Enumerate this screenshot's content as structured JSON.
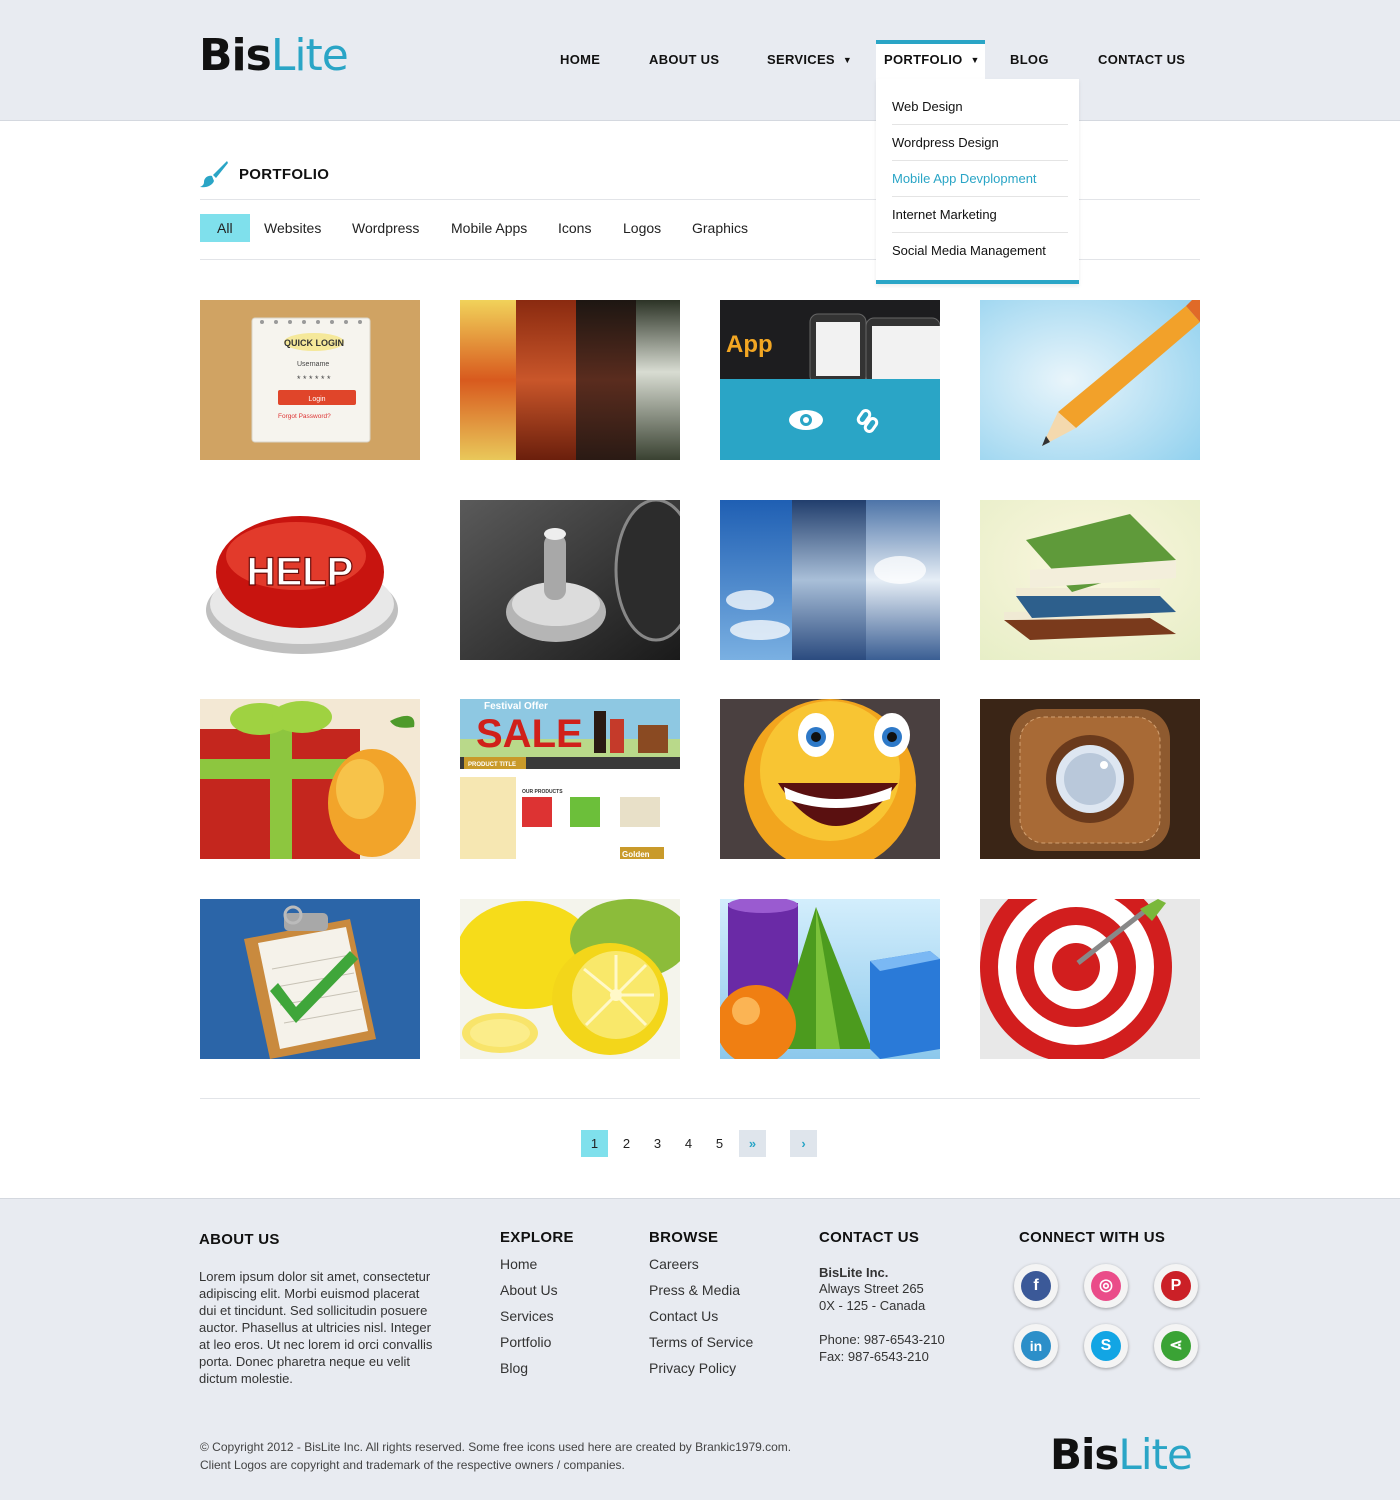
{
  "brand": {
    "part1": "Bis",
    "part2": "Lite"
  },
  "colors": {
    "accent": "#2aa5c6",
    "highlight": "#7fe0ec",
    "header_bg": "#e8ebf1"
  },
  "nav": {
    "items": [
      {
        "label": "HOME"
      },
      {
        "label": "ABOUT US"
      },
      {
        "label": "SERVICES",
        "has_dropdown": true
      },
      {
        "label": "PORTFOLIO",
        "has_dropdown": true,
        "active": true
      },
      {
        "label": "BLOG"
      },
      {
        "label": "CONTACT US"
      }
    ],
    "dropdown": [
      {
        "label": "Web Design"
      },
      {
        "label": "Wordpress Design"
      },
      {
        "label": "Mobile App Devplopment",
        "highlighted": true
      },
      {
        "label": "Internet Marketing"
      },
      {
        "label": "Social Media Management"
      }
    ]
  },
  "page": {
    "title": "PORTFOLIO",
    "title_icon": "paintbrush-icon"
  },
  "filters": [
    {
      "label": "All",
      "active": true
    },
    {
      "label": "Websites"
    },
    {
      "label": "Wordpress"
    },
    {
      "label": "Mobile Apps"
    },
    {
      "label": "Icons"
    },
    {
      "label": "Logos"
    },
    {
      "label": "Graphics"
    }
  ],
  "portfolio": [
    {
      "name": "quick-login-notepad",
      "text": "QUICK LOGIN",
      "sub": [
        "Username",
        "Login",
        "Forgot Password?"
      ]
    },
    {
      "name": "texture-strips"
    },
    {
      "name": "app-showcase",
      "text": "App",
      "hover_icons": [
        "eye-icon",
        "link-icon"
      ]
    },
    {
      "name": "pencil-icon-art"
    },
    {
      "name": "help-button",
      "text": "HELP"
    },
    {
      "name": "spinning-top-photo"
    },
    {
      "name": "sky-textures"
    },
    {
      "name": "books-stack"
    },
    {
      "name": "gift-and-mango"
    },
    {
      "name": "festival-sale-site",
      "text": "SALE",
      "sub": [
        "Festival Offer",
        "PRODUCT TITLE",
        "OUR PRODUCTS",
        "Golden"
      ]
    },
    {
      "name": "smiley-face"
    },
    {
      "name": "leather-knob-icon"
    },
    {
      "name": "clipboard-check"
    },
    {
      "name": "lemons"
    },
    {
      "name": "3d-shapes"
    },
    {
      "name": "target-dart"
    }
  ],
  "pagination": {
    "pages": [
      "1",
      "2",
      "3",
      "4",
      "5"
    ],
    "current": "1",
    "last": "»",
    "next": "›"
  },
  "footer": {
    "about": {
      "heading": "ABOUT US",
      "text": "Lorem ipsum dolor sit amet, consectetur adipiscing elit. Morbi euismod placerat dui et tincidunt. Sed sollicitudin posuere auctor. Phasellus at ultricies nisl. Integer at leo eros. Ut nec lorem id orci convallis porta. Donec pharetra neque eu velit dictum molestie."
    },
    "explore": {
      "heading": "EXPLORE",
      "links": [
        "Home",
        "About Us",
        "Services",
        "Portfolio",
        "Blog"
      ]
    },
    "browse": {
      "heading": "BROWSE",
      "links": [
        "Careers",
        "Press & Media",
        "Contact Us",
        "Terms of Service",
        "Privacy Policy"
      ]
    },
    "contact": {
      "heading": "CONTACT US",
      "company": "BisLite Inc.",
      "address1": "Always Street 265",
      "address2": "0X - 125 - Canada",
      "phone": "Phone: 987-6543-210",
      "fax": "Fax: 987-6543-210"
    },
    "connect": {
      "heading": "CONNECT WITH US",
      "networks": [
        {
          "name": "facebook",
          "icon": "facebook-icon",
          "glyph": "f",
          "color": "#3b5998"
        },
        {
          "name": "dribbble",
          "icon": "dribbble-icon",
          "glyph": "◎",
          "color": "#ea4c89"
        },
        {
          "name": "pinterest",
          "icon": "pinterest-icon",
          "glyph": "P",
          "color": "#cb2027"
        },
        {
          "name": "linkedin",
          "icon": "linkedin-icon",
          "glyph": "in",
          "color": "#2c8fc9"
        },
        {
          "name": "skype",
          "icon": "skype-icon",
          "glyph": "S",
          "color": "#12a5e4"
        },
        {
          "name": "share",
          "icon": "share-icon",
          "glyph": "⋖",
          "color": "#3aa335"
        }
      ]
    },
    "copyright_line1": "© Copyright 2012 - BisLite Inc. All rights reserved. Some free icons used here are created by Brankic1979.com.",
    "copyright_line2": "Client Logos are copyright and trademark of the respective owners / companies."
  }
}
